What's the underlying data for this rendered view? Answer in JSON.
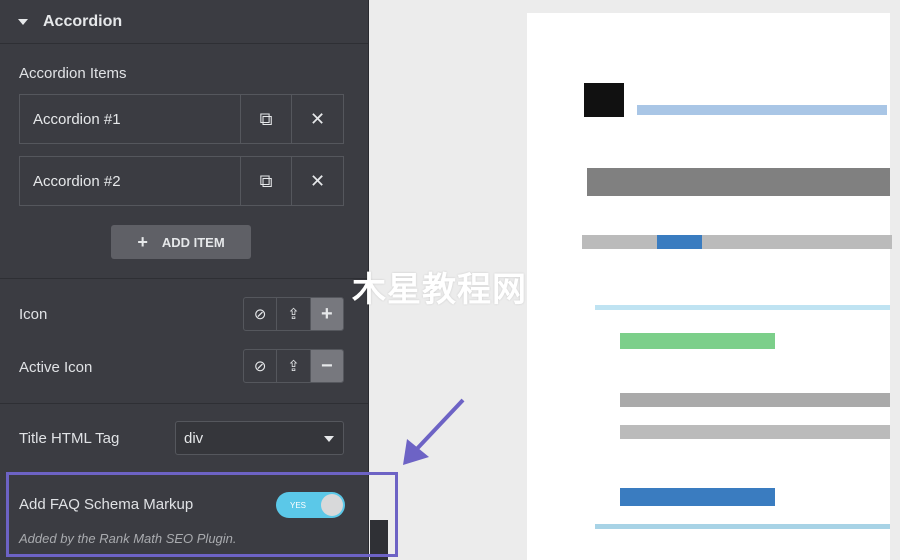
{
  "panel": {
    "section_title": "Accordion",
    "items_label": "Accordion Items",
    "items": [
      {
        "label": "Accordion #1"
      },
      {
        "label": "Accordion #2"
      }
    ],
    "add_item": "ADD ITEM",
    "icon_label": "Icon",
    "active_icon_label": "Active Icon",
    "title_tag_label": "Title HTML Tag",
    "title_tag_value": "div",
    "faq_label": "Add FAQ Schema Markup",
    "faq_toggle": "YES",
    "faq_enabled": true,
    "faq_note": "Added by the Rank Math SEO Plugin."
  },
  "colors": {
    "highlight": "#6d63c5",
    "toggle": "#5bc8e8",
    "panel": "#3b3c42"
  },
  "watermark": "木星教程网"
}
